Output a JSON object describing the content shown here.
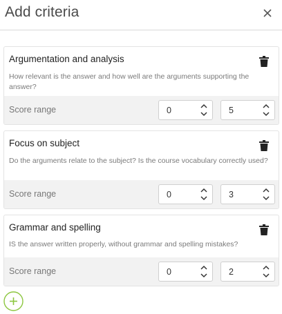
{
  "dialog": {
    "title": "Add criteria",
    "close_icon": "close-icon",
    "accent_color": "#8cc63f",
    "add_icon": "plus-circle-icon"
  },
  "criteria": [
    {
      "title": "Argumentation and analysis",
      "description": "How relevant is the answer and how well are the arguments supporting the answer?",
      "score_label": "Score range",
      "min": "0",
      "max": "5"
    },
    {
      "title": "Focus on subject",
      "description": "Do the arguments relate to the subject? Is the course vocabulary correctly used?",
      "score_label": "Score range",
      "min": "0",
      "max": "3"
    },
    {
      "title": "Grammar and spelling",
      "description": "IS the answer written properly, without grammar and spelling mistakes?",
      "score_label": "Score range",
      "min": "0",
      "max": "2"
    }
  ]
}
